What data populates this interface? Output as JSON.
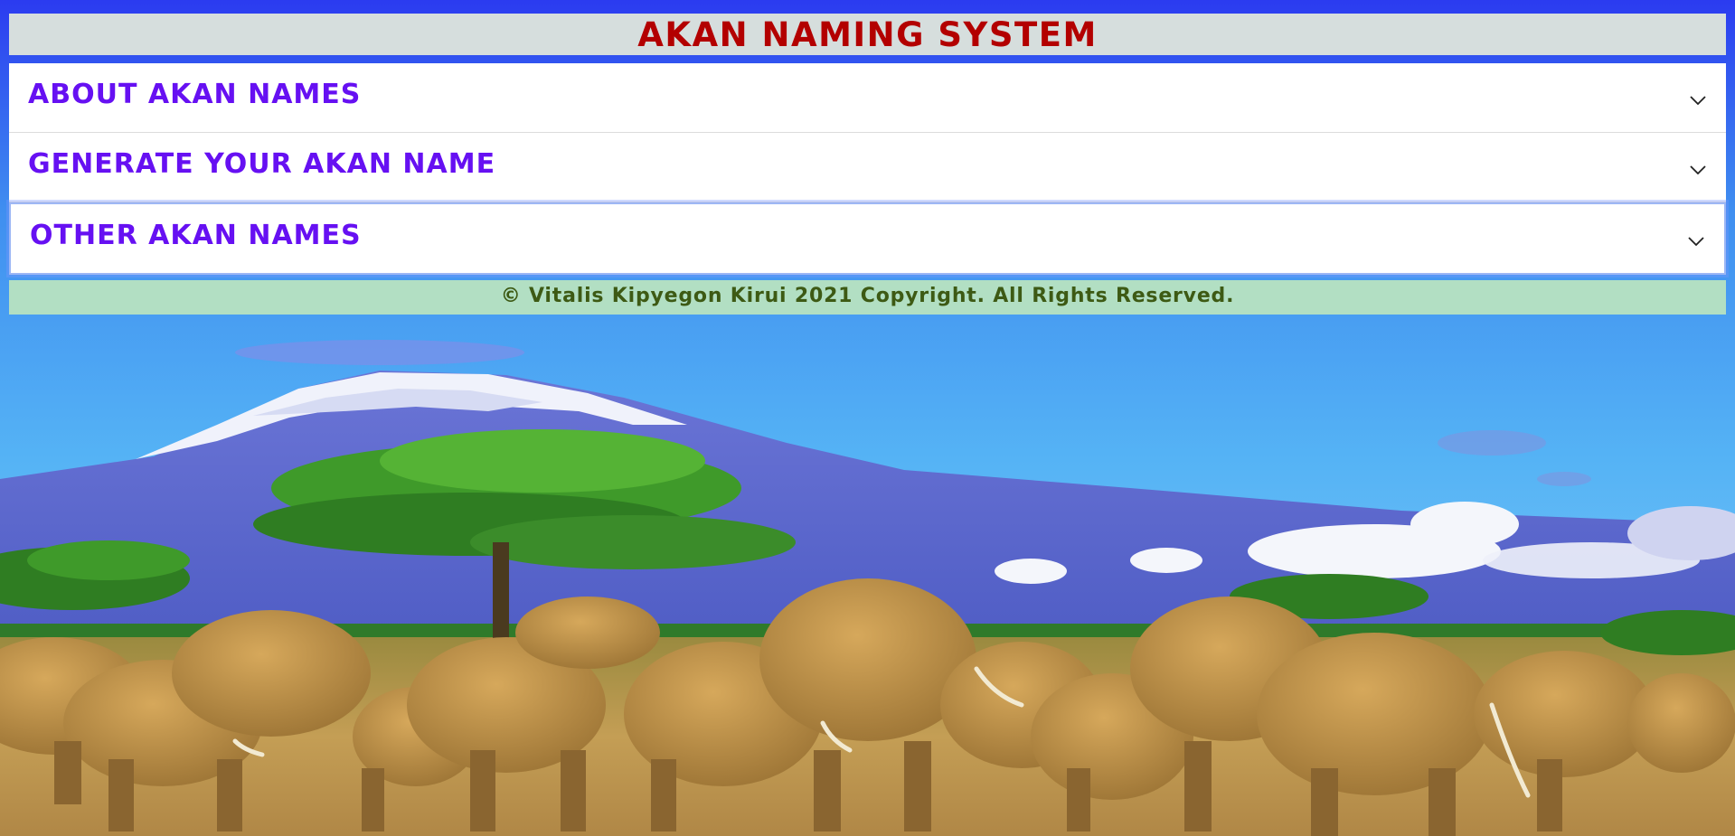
{
  "header": {
    "title": "AKAN NAMING SYSTEM",
    "title_color": "#b30000",
    "background_color": "#d6dedd"
  },
  "accordion": {
    "items": [
      {
        "label": "ABOUT AKAN NAMES",
        "icon": "chevron-down-icon",
        "expanded": false
      },
      {
        "label": "GENERATE YOUR AKAN NAME",
        "icon": "chevron-down-icon",
        "expanded": false
      },
      {
        "label": "OTHER AKAN NAMES",
        "icon": "chevron-down-icon",
        "expanded": false,
        "focused": true
      }
    ],
    "label_color": "#6610f2"
  },
  "footer": {
    "text": "© Vitalis Kipyegon Kirui 2021 Copyright. All Rights Reserved.",
    "text_color": "#3d5a14",
    "background_color": "#b2dfc3"
  },
  "background": {
    "image": "savanna-elephants-kilimanjaro-photo",
    "sky_color": "#4aa3f0",
    "ground_color": "#c29a4c"
  }
}
